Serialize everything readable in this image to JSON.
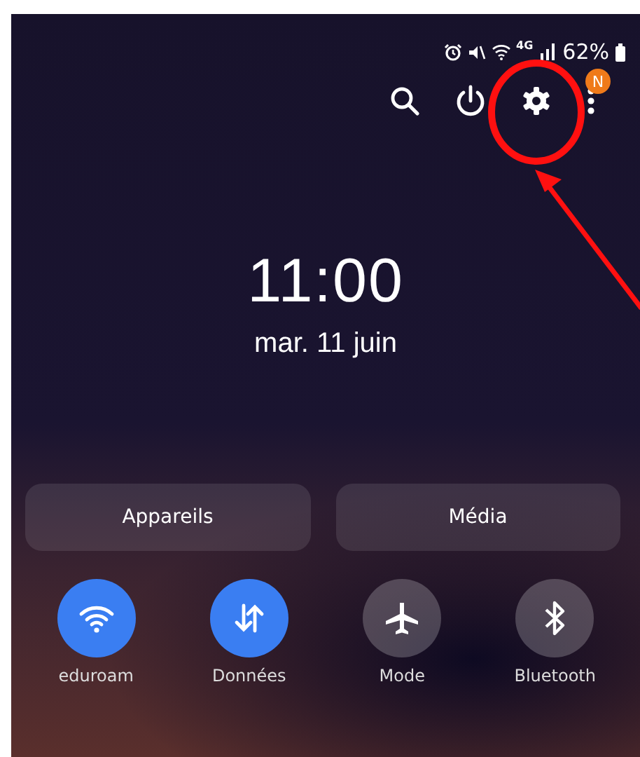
{
  "status_bar": {
    "battery": "62%",
    "network": "4G"
  },
  "toolbar": {
    "notification_badge": "N"
  },
  "clock": {
    "time": "11:00",
    "date": "mar. 11 juin"
  },
  "buttons": [
    "Appareils",
    "Média"
  ],
  "toggles": [
    {
      "kind": "wifi",
      "label": "eduroam",
      "on": true
    },
    {
      "kind": "data",
      "label": "Données",
      "on": true
    },
    {
      "kind": "airplane",
      "label": "Mode",
      "on": false
    },
    {
      "kind": "bluetooth",
      "label": "Bluetooth",
      "on": false
    }
  ]
}
